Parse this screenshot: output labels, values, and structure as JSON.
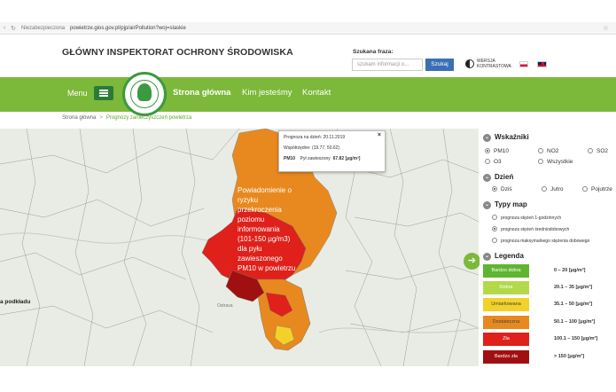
{
  "browser": {
    "security": "Niezabezpieczona",
    "url": "powietrze.gios.gov.pl/pjp/airPollution?woj=slaskie"
  },
  "header": {
    "site_title": "GŁÓWNY INSPEKTORAT OCHRONY ŚRODOWISKA",
    "search_label": "Szukana fraza:",
    "search_placeholder": "szukam informacji o...",
    "search_button": "Szukaj",
    "contrast_label": "WERSJA KONTRASTOWA"
  },
  "nav": {
    "menu_label": "Menu",
    "items": [
      {
        "label": "Strona główna"
      },
      {
        "label": "Kim jesteśmy"
      },
      {
        "label": "Kontakt"
      }
    ]
  },
  "breadcrumb": {
    "home": "Strona główna",
    "separator": ">",
    "current": "Prognozy zanieczyszczeń powietrza"
  },
  "map": {
    "tooltip": {
      "forecast_label": "Prognoza na dzień: 20.11.2019",
      "coords_label": "Współrzędne: (19.77, 50.62)",
      "pollutant": "PM10",
      "pollutant_desc": "Pył zawieszony",
      "value": "67.82 [μg/m³]"
    },
    "alert_text": "Powiadomienie o ryzyku przekroczenia poziomu informowania (101-150 μg/m3) dla pyłu zawieszonego PM10 w powietrzu",
    "podklad": "a podkładu",
    "labels": [
      "Ostrava"
    ],
    "colors": {
      "dostateczna": "#e8891f",
      "zla": "#e0201a",
      "bardzo_zla": "#a01010",
      "umiarkowana": "#f2d22a"
    }
  },
  "panel": {
    "wskazniki": {
      "title": "Wskaźniki",
      "options": [
        "PM10",
        "NO2",
        "SO2",
        "O3",
        "Wszystkie"
      ],
      "selected": "PM10"
    },
    "dzien": {
      "title": "Dzień",
      "options": [
        "Dziś",
        "Jutro",
        "Pojutrze"
      ],
      "selected": "Dziś"
    },
    "typy_map": {
      "title": "Typy map",
      "options": [
        "prognoza stężeń 1-godzinnych",
        "prognoza stężeń średniodobowych",
        "prognoza maksymalnego stężenia dobowego"
      ],
      "selected": "prognoza stężeń średniodobowych"
    },
    "legenda": {
      "title": "Legenda",
      "items": [
        {
          "label": "Bardzo dobra",
          "range": "0 – 20 [μg/m³]",
          "color": "#5fb530"
        },
        {
          "label": "Dobra",
          "range": "20.1 – 35 [μg/m³]",
          "color": "#b3d94a"
        },
        {
          "label": "Umiarkowana",
          "range": "35.1 – 50 [μg/m³]",
          "color": "#f2d22a"
        },
        {
          "label": "Dostateczna",
          "range": "50.1 – 100 [μg/m³]",
          "color": "#e8891f"
        },
        {
          "label": "Zła",
          "range": "100.1 – 150 [μg/m³]",
          "color": "#e0201a"
        },
        {
          "label": "Bardzo zła",
          "range": "> 150 [μg/m³]",
          "color": "#a01010"
        }
      ]
    }
  }
}
